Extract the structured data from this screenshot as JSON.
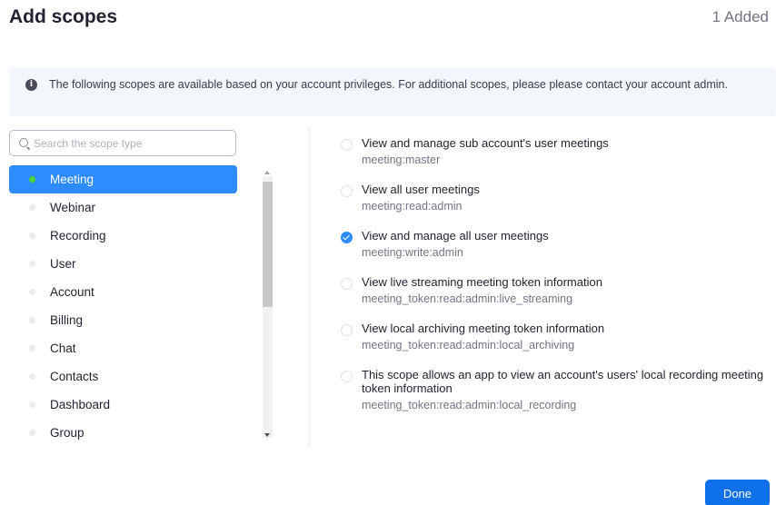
{
  "header": {
    "title": "Add scopes",
    "added_count": "1 Added"
  },
  "banner": {
    "icon": "info-icon",
    "message": "The following scopes are available based on your account privileges. For additional scopes, please please contact your account admin."
  },
  "search": {
    "placeholder": "Search the scope type",
    "value": ""
  },
  "categories": [
    {
      "label": "Meeting",
      "active": true
    },
    {
      "label": "Webinar"
    },
    {
      "label": "Recording"
    },
    {
      "label": "User"
    },
    {
      "label": "Account"
    },
    {
      "label": "Billing"
    },
    {
      "label": "Chat"
    },
    {
      "label": "Contacts"
    },
    {
      "label": "Dashboard"
    },
    {
      "label": "Group"
    }
  ],
  "scopes": [
    {
      "label": "View and manage sub account's user meetings",
      "code": "meeting:master",
      "checked": false
    },
    {
      "label": "View all user meetings",
      "code": "meeting:read:admin",
      "checked": false
    },
    {
      "label": "View and manage all user meetings",
      "code": "meeting:write:admin",
      "checked": true
    },
    {
      "label": "View live streaming meeting token information",
      "code": "meeting_token:read:admin:live_streaming",
      "checked": false
    },
    {
      "label": "View local archiving meeting token information",
      "code": "meeting_token:read:admin:local_archiving",
      "checked": false
    },
    {
      "label": "This scope allows an app to view an account's users' local recording meeting token information",
      "code": "meeting_token:read:admin:local_recording",
      "checked": false
    }
  ],
  "footer": {
    "done_label": "Done"
  },
  "colors": {
    "accent": "#2d8cff",
    "done_button": "#0e71eb",
    "active_dot": "#4cd137"
  }
}
